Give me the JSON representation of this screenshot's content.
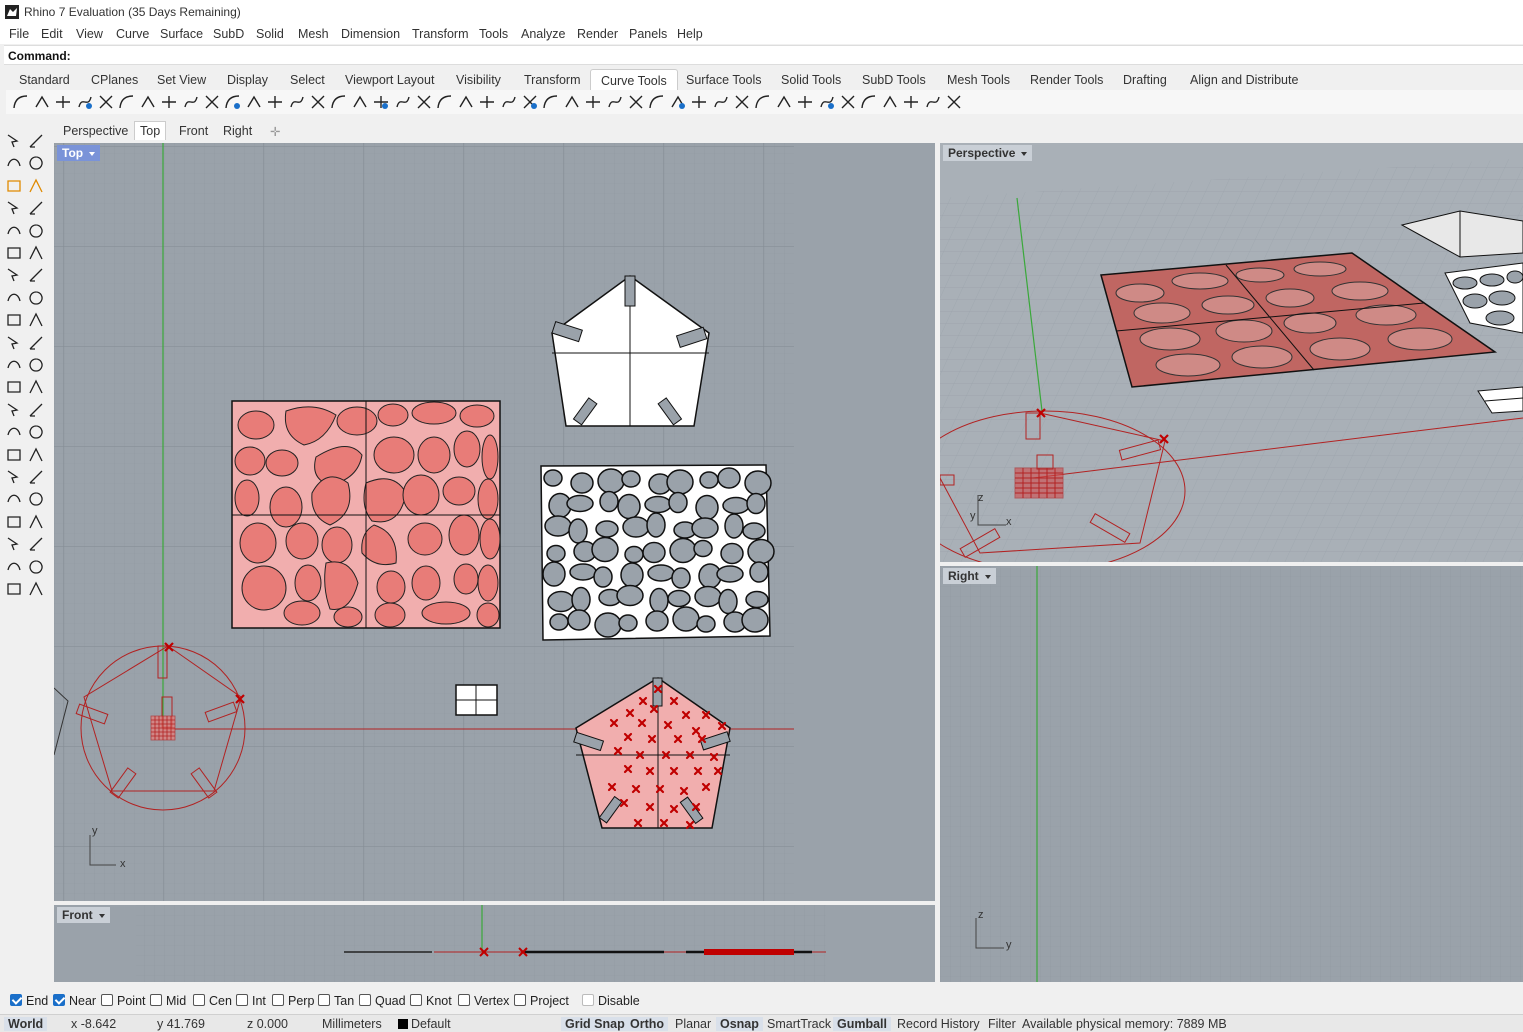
{
  "window": {
    "title": "Rhino 7 Evaluation (35 Days Remaining)"
  },
  "menu": [
    "File",
    "Edit",
    "View",
    "Curve",
    "Surface",
    "SubD",
    "Solid",
    "Mesh",
    "Dimension",
    "Transform",
    "Tools",
    "Analyze",
    "Render",
    "Panels",
    "Help"
  ],
  "command": {
    "prompt": "Command:"
  },
  "toolbar_tabs": [
    "Standard",
    "CPlanes",
    "Set View",
    "Display",
    "Select",
    "Viewport Layout",
    "Visibility",
    "Transform",
    "Curve Tools",
    "Surface Tools",
    "Solid Tools",
    "SubD Tools",
    "Mesh Tools",
    "Render Tools",
    "Drafting",
    "Align and Distribute"
  ],
  "active_toolbar_tab": "Curve Tools",
  "viewport_tabs": [
    "Perspective",
    "Top",
    "Front",
    "Right"
  ],
  "active_viewport_tab": "Top",
  "viewports": {
    "top": "Top",
    "perspective": "Perspective",
    "right": "Right",
    "front": "Front"
  },
  "axes": {
    "x": "x",
    "y": "y",
    "z": "z"
  },
  "osnap": [
    {
      "label": "End",
      "checked": true
    },
    {
      "label": "Near",
      "checked": true
    },
    {
      "label": "Point",
      "checked": false
    },
    {
      "label": "Mid",
      "checked": false
    },
    {
      "label": "Cen",
      "checked": false
    },
    {
      "label": "Int",
      "checked": false
    },
    {
      "label": "Perp",
      "checked": false
    },
    {
      "label": "Tan",
      "checked": false
    },
    {
      "label": "Quad",
      "checked": false
    },
    {
      "label": "Knot",
      "checked": false
    },
    {
      "label": "Vertex",
      "checked": false
    },
    {
      "label": "Project",
      "checked": false
    },
    {
      "label": "Disable",
      "checked": false
    }
  ],
  "status": {
    "cplane": "World",
    "x": "x -8.642",
    "y": "y 41.769",
    "z": "z 0.000",
    "units": "Millimeters",
    "layer": "Default",
    "grid_snap": "Grid Snap",
    "ortho": "Ortho",
    "planar": "Planar",
    "osnap": "Osnap",
    "smarttrack": "SmartTrack",
    "gumball": "Gumball",
    "record_history": "Record History",
    "filter": "Filter",
    "memory": "Available physical memory: 7889 MB"
  },
  "colors": {
    "viewport_bg": "#9aa2aa",
    "active_label": "#7a93d8",
    "red_fill": "#e87c78",
    "red_light": "#f1aeae",
    "red_line": "#b22222",
    "y_axis": "#3aa83a"
  }
}
